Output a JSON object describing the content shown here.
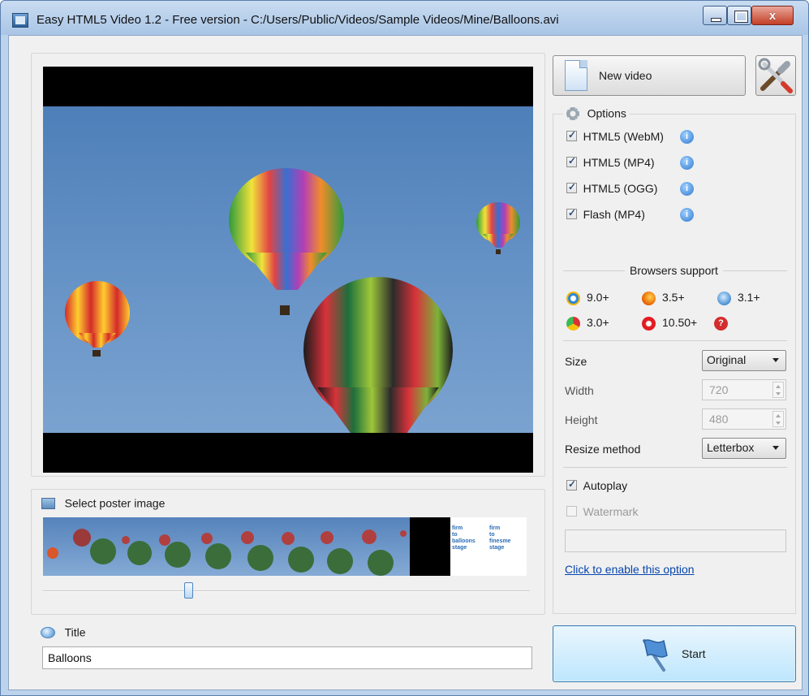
{
  "window": {
    "title": "Easy HTML5 Video 1.2 - Free version - C:/Users/Public/Videos/Sample Videos/Mine/Balloons.avi",
    "close_glyph": "x"
  },
  "poster": {
    "label": "Select poster image",
    "film_text_1": "firm\nto\nballoons\nstage",
    "film_text_2": "firm\nto\nfinesme\nstage"
  },
  "title_section": {
    "label": "Title",
    "value": "Balloons"
  },
  "toolbar": {
    "new_video_label": "New video"
  },
  "options": {
    "header": "Options",
    "formats": [
      {
        "label": "HTML5 (WebM)",
        "checked": true
      },
      {
        "label": "HTML5 (MP4)",
        "checked": true
      },
      {
        "label": "HTML5 (OGG)",
        "checked": true
      },
      {
        "label": "Flash (MP4)",
        "checked": true
      }
    ],
    "info_glyph": "i",
    "browsers_support_label": "Browsers support",
    "browsers": [
      {
        "icon": "ie-icon",
        "version": "9.0+"
      },
      {
        "icon": "firefox-icon",
        "version": "3.5+"
      },
      {
        "icon": "safari-icon",
        "version": "3.1+"
      },
      {
        "icon": "chrome-icon",
        "version": "3.0+"
      },
      {
        "icon": "opera-icon",
        "version": "10.50+"
      },
      {
        "icon": "help-icon",
        "version": ""
      }
    ],
    "help_glyph": "?",
    "size_label": "Size",
    "size_value": "Original",
    "width_label": "Width",
    "width_value": "720",
    "height_label": "Height",
    "height_value": "480",
    "resize_label": "Resize method",
    "resize_value": "Letterbox",
    "autoplay_label": "Autoplay",
    "autoplay_checked": true,
    "watermark_label": "Watermark",
    "watermark_checked": false,
    "enable_link": "Click to enable this option"
  },
  "start": {
    "label": "Start"
  },
  "poster_position": 0.3,
  "colors": {
    "accent": "#3c7fb1",
    "link": "#0645ad",
    "sky": "#5f8fc4"
  }
}
